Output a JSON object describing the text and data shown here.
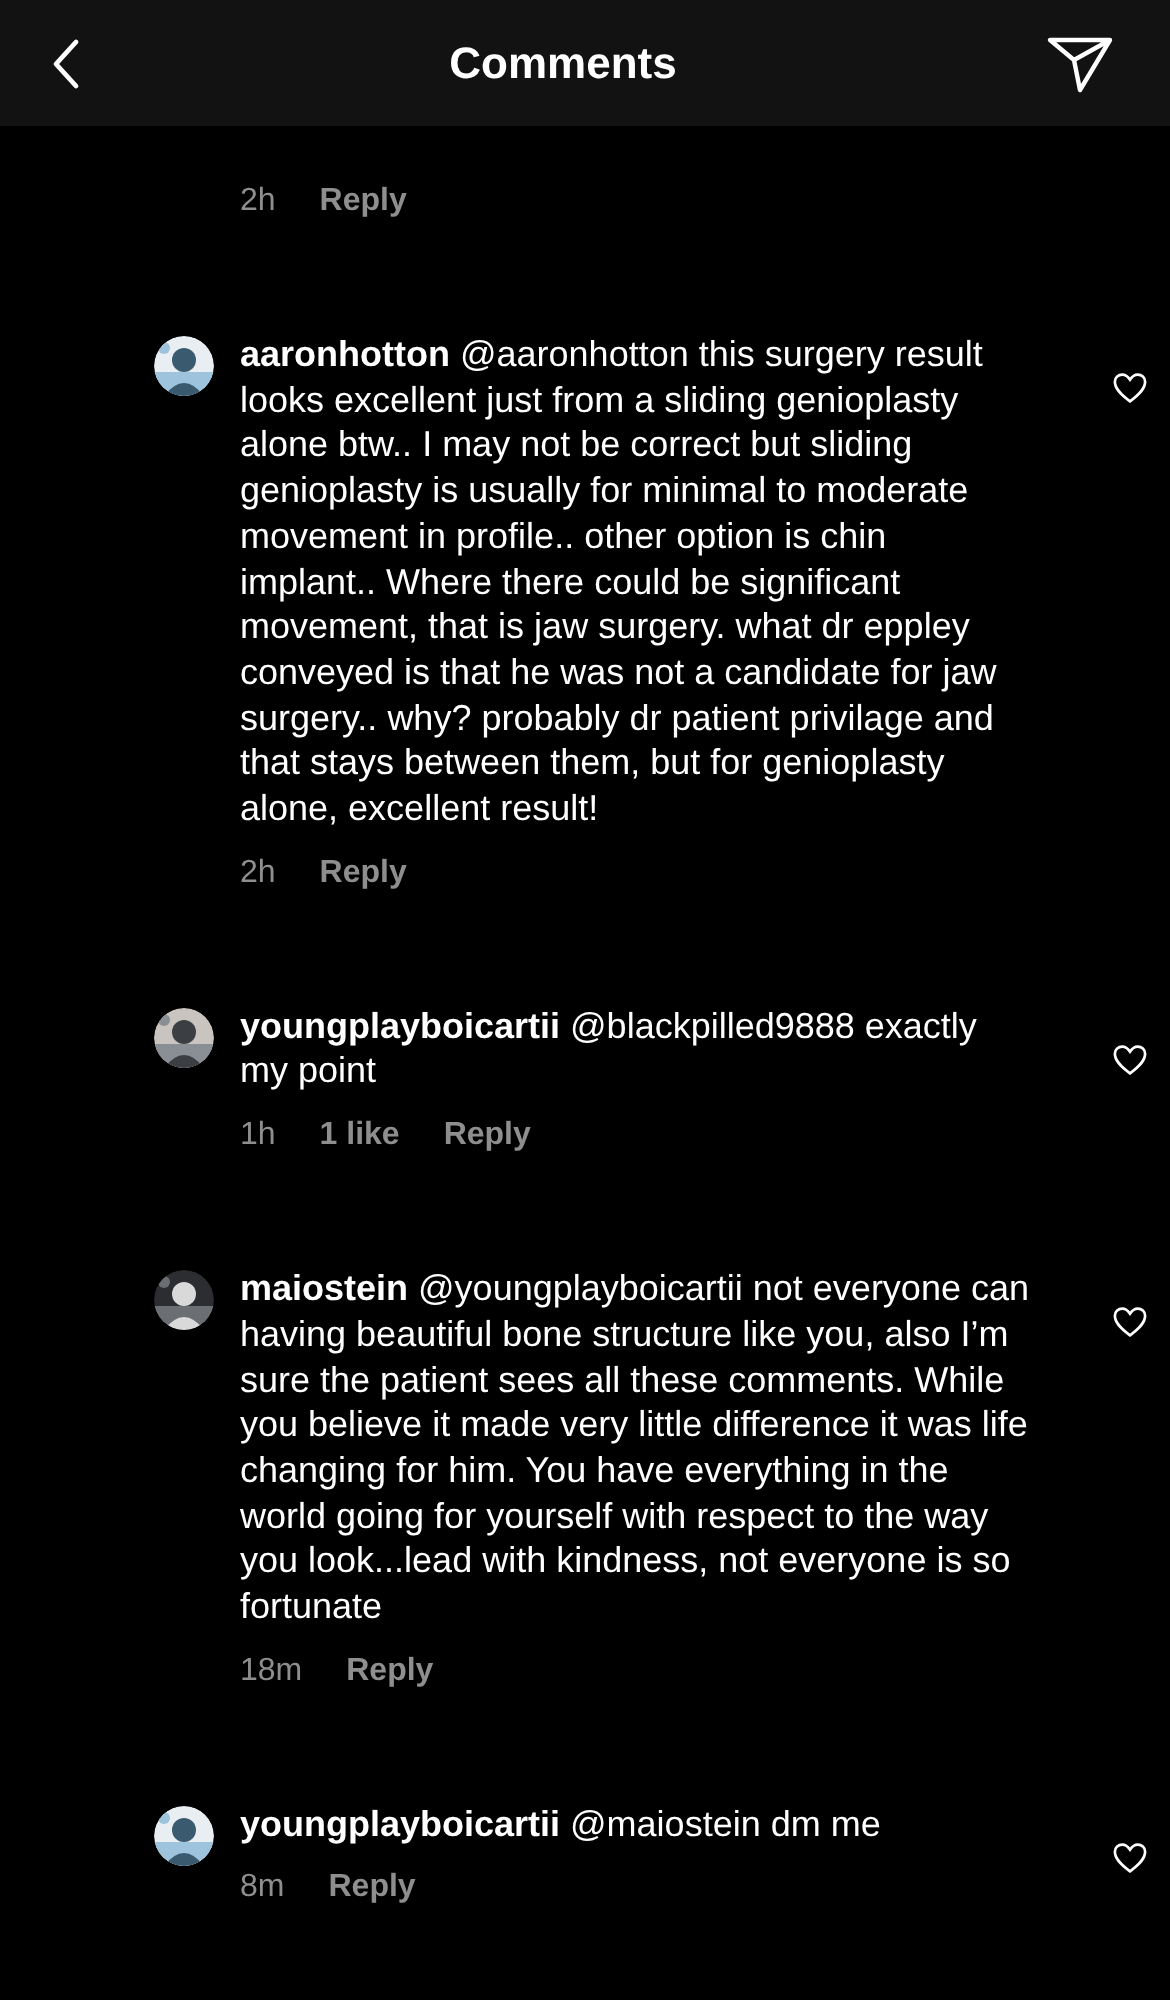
{
  "header": {
    "title": "Comments"
  },
  "comments": [
    {
      "kind": "tail",
      "time": "2h",
      "reply": "Reply"
    },
    {
      "kind": "full",
      "username": "aaronhotton",
      "text": "@aaronhotton this surgery result looks excellent just from a sliding genioplasty alone btw.. I may not be correct but sliding genioplasty is usually for minimal to moderate movement in profile.. other option is chin implant.. Where there could be significant movement, that is jaw surgery. what dr eppley conveyed is that he was not a candidate for jaw surgery.. why? probably dr patient privilage and that stays between them, but for genioplasty alone, excellent result!",
      "time": "2h",
      "reply": "Reply"
    },
    {
      "kind": "full",
      "username": "youngplayboicartii",
      "text": "@blackpilled9888 exactly my point",
      "time": "1h",
      "likes": "1 like",
      "reply": "Reply"
    },
    {
      "kind": "full",
      "username": "maiostein",
      "text": "@youngplayboicartii not everyone can having beautiful bone structure like you, also I’m sure the patient sees all these comments. While you believe it made very little difference it was life changing for him. You have everything in the world going for yourself with respect to the way you look...lead with kindness, not everyone is so fortunate",
      "time": "18m",
      "reply": "Reply"
    },
    {
      "kind": "full",
      "username": "youngplayboicartii",
      "text": "@maiostein dm me",
      "time": "8m",
      "reply": "Reply"
    }
  ]
}
